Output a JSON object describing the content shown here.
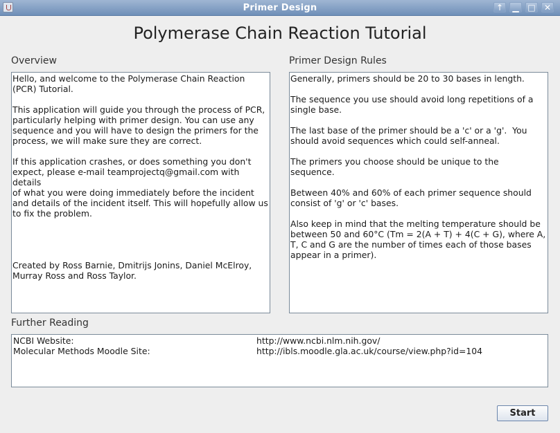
{
  "window": {
    "title": "Primer Design",
    "app_icon": "java-icon",
    "controls": [
      {
        "name": "pin",
        "glyph": "↑"
      },
      {
        "name": "minimize",
        "glyph": "▁"
      },
      {
        "name": "maximize",
        "glyph": "□"
      },
      {
        "name": "close",
        "glyph": "✕"
      }
    ]
  },
  "page": {
    "title": "Polymerase Chain Reaction Tutorial"
  },
  "overview": {
    "label": "Overview",
    "paragraphs": [
      "Hello, and welcome to the Polymerase Chain Reaction\n(PCR) Tutorial.",
      "This application will guide you through the process of PCR,\nparticularly helping with primer design. You can use any\nsequence and you will have to design the primers for the\nprocess, we will make sure they are correct.",
      "If this application crashes, or does something you don't\nexpect, please e-mail teamprojectq@gmail.com with details\nof what you were doing immediately before the incident\nand details of the incident itself. This will hopefully allow us\nto fix the problem.",
      "Created by Ross Barnie, Dmitrijs Jonins, Daniel McElroy,\nMurray Ross and Ross Taylor."
    ]
  },
  "rules": {
    "label": "Primer Design Rules",
    "paragraphs": [
      "Generally, primers should be 20 to 30 bases in length.",
      "The sequence you use should avoid long repetitions of a\nsingle base.",
      "The last base of the primer should be a 'c' or a 'g'.  You\nshould avoid sequences which could self-anneal.",
      "The primers you choose should be unique to the\nsequence.",
      "Between 40% and 60% of each primer sequence should\nconsist of 'g' or 'c' bases.",
      "Also keep in mind that the melting temperature should be\nbetween 50 and 60°C (Tm = 2(A + T) + 4(C + G), where A,\nT, C and G are the number of times each of those bases\nappear in a primer)."
    ]
  },
  "further_reading": {
    "label": "Further Reading",
    "links": [
      {
        "name": "NCBI Website:",
        "url": "http://www.ncbi.nlm.nih.gov/"
      },
      {
        "name": "Molecular Methods Moodle Site:",
        "url": "http://ibls.moodle.gla.ac.uk/course/view.php?id=104"
      }
    ]
  },
  "actions": {
    "start_label": "Start"
  }
}
